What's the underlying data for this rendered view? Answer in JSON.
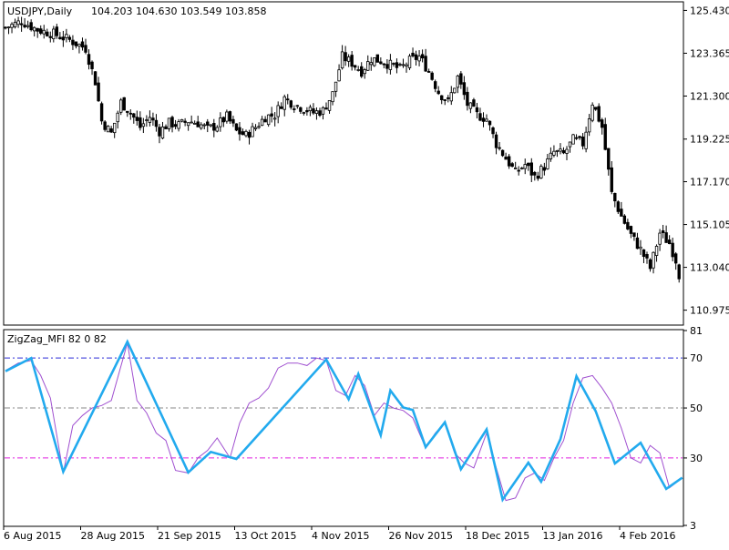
{
  "header": {
    "symbol": "USDJPY,Daily",
    "ohlc": "104.203 104.630 103.549 103.858"
  },
  "indicator": {
    "title": "ZigZag_MFI 82 0 82",
    "levels": [
      {
        "value": 70,
        "color": "#2a2ad8",
        "label": "70"
      },
      {
        "value": 50,
        "color": "#8a8a8a",
        "label": "50"
      },
      {
        "value": 30,
        "color": "#e020e0",
        "label": "30"
      }
    ],
    "axis_labels": [
      "81",
      "70",
      "50",
      "30",
      "3"
    ]
  },
  "price_axis_labels": [
    "125.430",
    "123.365",
    "121.300",
    "119.225",
    "117.170",
    "115.105",
    "113.040",
    "110.975"
  ],
  "date_labels": [
    "6 Aug 2015",
    "28 Aug 2015",
    "21 Sep 2015",
    "13 Oct 2015",
    "4 Nov 2015",
    "26 Nov 2015",
    "18 Dec 2015",
    "13 Jan 2016",
    "4 Feb 2016"
  ],
  "colors": {
    "zigzag": "#22aaee",
    "mfi": "#a050d0",
    "candle": "#000000",
    "background": "#ffffff"
  },
  "chart_data": [
    {
      "type": "candlestick",
      "title": "USDJPY,Daily",
      "ylim": [
        110.3,
        125.8
      ],
      "close_path": [
        [
          0,
          124.6
        ],
        [
          5,
          124.9
        ],
        [
          10,
          124.5
        ],
        [
          15,
          124.3
        ],
        [
          20,
          124.0
        ],
        [
          25,
          123.6
        ],
        [
          28,
          122.0
        ],
        [
          30,
          120.1
        ],
        [
          33,
          119.5
        ],
        [
          36,
          121.0
        ],
        [
          39,
          120.5
        ],
        [
          42,
          119.8
        ],
        [
          45,
          120.3
        ],
        [
          48,
          119.6
        ],
        [
          51,
          120.0
        ],
        [
          54,
          119.9
        ],
        [
          57,
          120.1
        ],
        [
          60,
          120.0
        ],
        [
          63,
          119.7
        ],
        [
          66,
          119.9
        ],
        [
          69,
          120.3
        ],
        [
          72,
          119.6
        ],
        [
          75,
          119.4
        ],
        [
          78,
          119.8
        ],
        [
          81,
          120.3
        ],
        [
          84,
          120.4
        ],
        [
          87,
          121.2
        ],
        [
          90,
          120.9
        ],
        [
          93,
          120.7
        ],
        [
          96,
          120.5
        ],
        [
          99,
          120.6
        ],
        [
          102,
          121.4
        ],
        [
          105,
          123.2
        ],
        [
          108,
          122.9
        ],
        [
          111,
          122.5
        ],
        [
          114,
          123.1
        ],
        [
          117,
          123.0
        ],
        [
          120,
          122.8
        ],
        [
          123,
          122.6
        ],
        [
          126,
          123.0
        ],
        [
          129,
          123.2
        ],
        [
          132,
          122.5
        ],
        [
          135,
          121.5
        ],
        [
          138,
          121.0
        ],
        [
          141,
          122.2
        ],
        [
          144,
          120.9
        ],
        [
          147,
          120.4
        ],
        [
          150,
          120.2
        ],
        [
          153,
          119.0
        ],
        [
          156,
          118.3
        ],
        [
          159,
          117.6
        ],
        [
          162,
          118.0
        ],
        [
          165,
          117.4
        ],
        [
          168,
          117.9
        ],
        [
          171,
          118.6
        ],
        [
          174,
          118.5
        ],
        [
          177,
          119.2
        ],
        [
          180,
          119.0
        ],
        [
          183,
          121.0
        ],
        [
          186,
          119.8
        ],
        [
          189,
          116.6
        ],
        [
          192,
          115.5
        ],
        [
          195,
          114.6
        ],
        [
          198,
          113.9
        ],
        [
          201,
          113.0
        ],
        [
          204,
          114.7
        ],
        [
          207,
          114.2
        ],
        [
          209,
          113.4
        ],
        [
          210,
          112.7
        ]
      ]
    },
    {
      "type": "line",
      "title": "ZigZag_MFI 82 0 82",
      "ylim": [
        3,
        81
      ],
      "series": [
        {
          "name": "ZigZag",
          "x": [
            0,
            8,
            18,
            38,
            57,
            64,
            72,
            100,
            107,
            110,
            117,
            120,
            124,
            127,
            131,
            137,
            142,
            150,
            155,
            163,
            167,
            173,
            178,
            184,
            190,
            198,
            206,
            211
          ],
          "values": [
            64.7,
            70,
            24.5,
            76.5,
            24.2,
            32.4,
            29.6,
            69.4,
            53.5,
            63.6,
            39.1,
            57.0,
            50.2,
            49.2,
            34.3,
            44.3,
            25.5,
            41.4,
            13.3,
            28.1,
            20.5,
            37.5,
            62.7,
            48.7,
            27.8,
            36.1,
            17.6,
            22.1
          ]
        },
        {
          "name": "MFI",
          "x": [
            0,
            4,
            8,
            11,
            14,
            18,
            21,
            24,
            27,
            30,
            33,
            38,
            41,
            44,
            47,
            50,
            53,
            57,
            60,
            63,
            66,
            70,
            73,
            76,
            79,
            82,
            85,
            88,
            91,
            94,
            97,
            100,
            103,
            106,
            109,
            112,
            115,
            118,
            121,
            124,
            127,
            131,
            134,
            137,
            140,
            143,
            146,
            150,
            153,
            156,
            159,
            162,
            165,
            168,
            171,
            174,
            177,
            180,
            183,
            186,
            189,
            192,
            195,
            198,
            201,
            204,
            207,
            211
          ],
          "values": [
            65,
            68,
            69,
            63,
            54,
            24,
            43,
            47,
            50,
            51,
            53,
            76,
            53,
            48,
            40,
            37,
            25,
            24,
            30,
            33,
            38,
            30,
            44,
            52,
            54,
            58,
            66,
            68,
            68,
            67,
            70,
            69,
            57,
            55,
            63,
            59,
            47,
            52,
            50,
            49,
            46,
            34,
            40,
            44,
            32,
            28,
            26,
            40,
            26,
            13,
            14,
            22,
            24,
            21,
            30,
            37,
            52,
            62,
            63,
            58,
            52,
            42,
            30,
            28,
            35,
            32,
            18,
            22
          ]
        }
      ],
      "levels": [
        70,
        50,
        30
      ]
    }
  ]
}
